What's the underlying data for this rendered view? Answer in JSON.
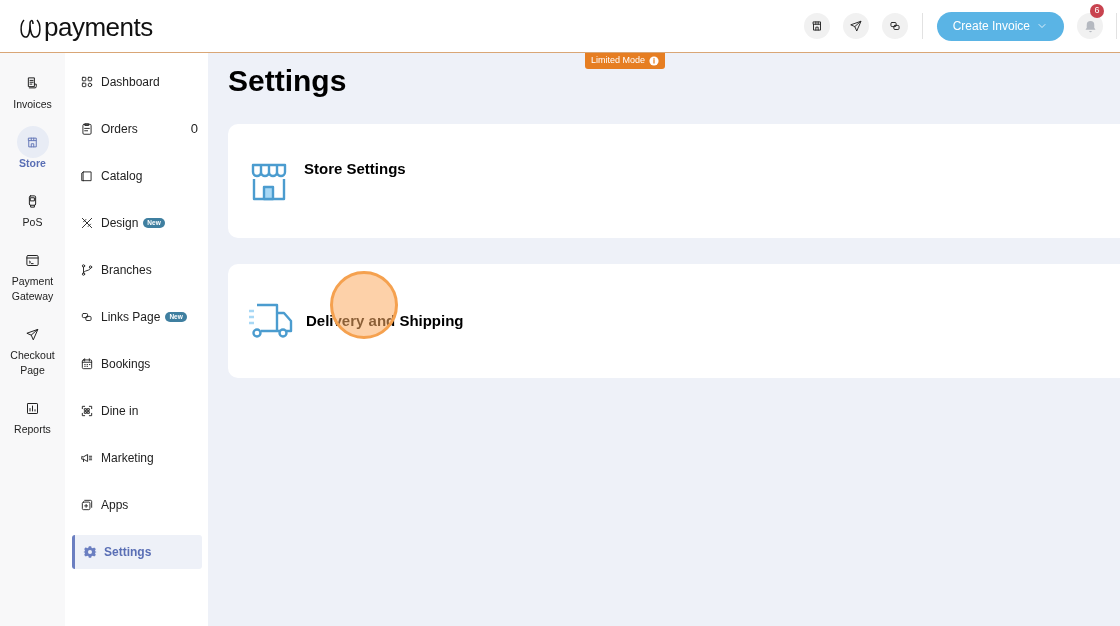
{
  "header": {
    "logo_text": "payments",
    "create_button": "Create Invoice",
    "notification_count": "6"
  },
  "limited_mode": {
    "label": "Limited Mode"
  },
  "rail": [
    {
      "label": "Invoices",
      "selected": false
    },
    {
      "label": "Store",
      "selected": true
    },
    {
      "label": "PoS",
      "selected": false
    },
    {
      "label": "Payment Gateway",
      "selected": false
    },
    {
      "label": "Checkout Page",
      "selected": false
    },
    {
      "label": "Reports",
      "selected": false
    }
  ],
  "sidebar": {
    "items": [
      {
        "label": "Dashboard",
        "selected": false
      },
      {
        "label": "Orders",
        "count": "0",
        "selected": false
      },
      {
        "label": "Catalog",
        "selected": false
      },
      {
        "label": "Design",
        "badge": "New",
        "selected": false
      },
      {
        "label": "Branches",
        "selected": false
      },
      {
        "label": "Links Page",
        "badge": "New",
        "selected": false
      },
      {
        "label": "Bookings",
        "selected": false
      },
      {
        "label": "Dine in",
        "selected": false
      },
      {
        "label": "Marketing",
        "selected": false
      },
      {
        "label": "Apps",
        "selected": false
      },
      {
        "label": "Settings",
        "selected": true
      }
    ]
  },
  "main": {
    "title": "Settings",
    "cards": [
      {
        "title": "Store Settings"
      },
      {
        "title": "Delivery and Shipping",
        "click_marker": true
      }
    ]
  }
}
